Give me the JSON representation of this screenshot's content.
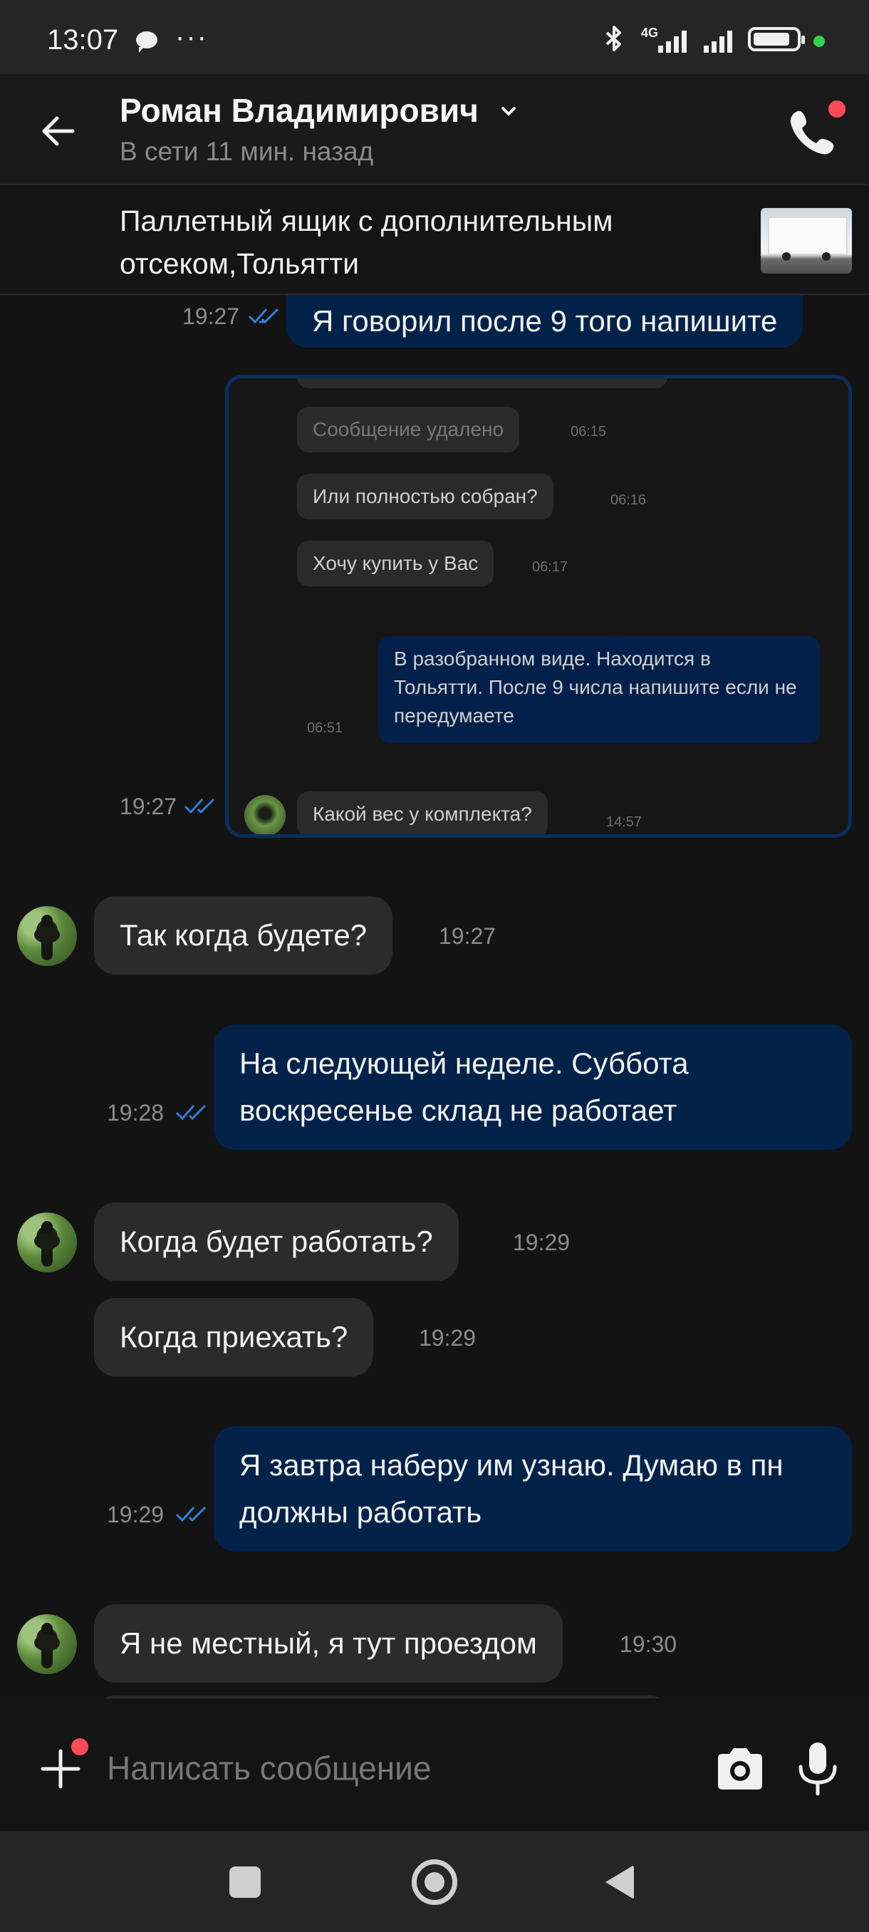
{
  "status_bar": {
    "time": "13:07",
    "more": "···",
    "network": "4G",
    "icons": [
      "chat-bubble-icon",
      "bluetooth-icon",
      "signal-icon",
      "battery-icon"
    ]
  },
  "header": {
    "contact_name": "Роман Владимирович",
    "status": "В сети 11 мин. назад",
    "icons": [
      "back-arrow-icon",
      "chevron-down-icon",
      "phone-icon"
    ]
  },
  "listing": {
    "title": "Паллетный ящик с дополнительным отсеком,Тольятти"
  },
  "messages": {
    "m1": {
      "text": "Я говорил после 9 того напишите",
      "time": "19:27"
    },
    "m2_image": {
      "time": "19:27",
      "inner": {
        "deleted": "Сообщение удалено",
        "deleted_time": "06:15",
        "q1": "Или полностью собран?",
        "q1_time": "06:16",
        "q2": "Хочу купить у Вас",
        "q2_time": "06:17",
        "reply": "В разобранном виде. Находится в Тольятти. После 9 числа напишите если не передумаете",
        "reply_time": "06:51",
        "q3": "Какой вес у комплекта?",
        "q3_time": "14:57"
      }
    },
    "m3": {
      "text": "Так когда будете?",
      "time": "19:27"
    },
    "m4": {
      "text": "На следующей неделе. Суббота воскресенье склад не работает",
      "time": "19:28"
    },
    "m5": {
      "text": "Когда будет работать?",
      "time": "19:29"
    },
    "m6": {
      "text": "Когда приехать?",
      "time": "19:29"
    },
    "m7": {
      "text": "Я завтра наберу им узнаю. Думаю в пн должны работать",
      "time": "19:29"
    },
    "m8": {
      "text": "Я не местный, я тут проездом",
      "time": "19:30"
    }
  },
  "composer": {
    "placeholder": "Написать сообщение",
    "icons": [
      "plus-icon",
      "camera-icon",
      "microphone-icon"
    ]
  },
  "colors": {
    "outgoing_bubble": "#03224a",
    "incoming_bubble": "#2b2b2b",
    "read_ticks": "#2f7fe0",
    "notification_dot": "#ff4b55"
  }
}
